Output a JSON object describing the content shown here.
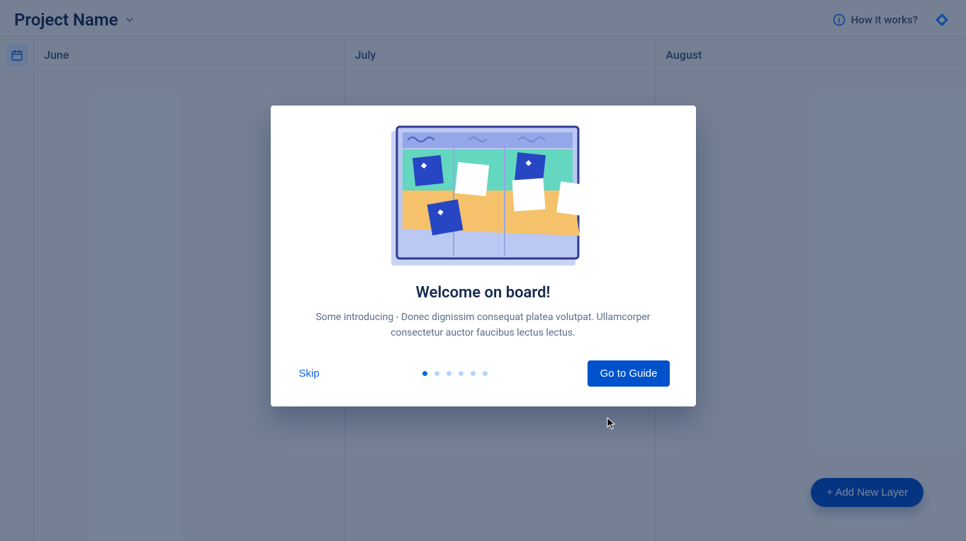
{
  "header": {
    "project_title": "Project Name",
    "how_it_works": "How it works?"
  },
  "timeline": {
    "months": [
      "June",
      "July",
      "August"
    ]
  },
  "fab": {
    "label": "+ Add New Layer"
  },
  "modal": {
    "title": "Welcome on board!",
    "body": "Some introducing - Donec dignissim consequat platea volutpat. Ullamcorper consectetur auctor faucibus lectus lectus.",
    "skip_label": "Skip",
    "cta_label": "Go to Guide",
    "step_count": 6,
    "current_step": 1
  },
  "colors": {
    "primary": "#0C66E4",
    "primary_dark": "#0052CC",
    "overlay": "rgba(9,30,66,0.54)"
  }
}
